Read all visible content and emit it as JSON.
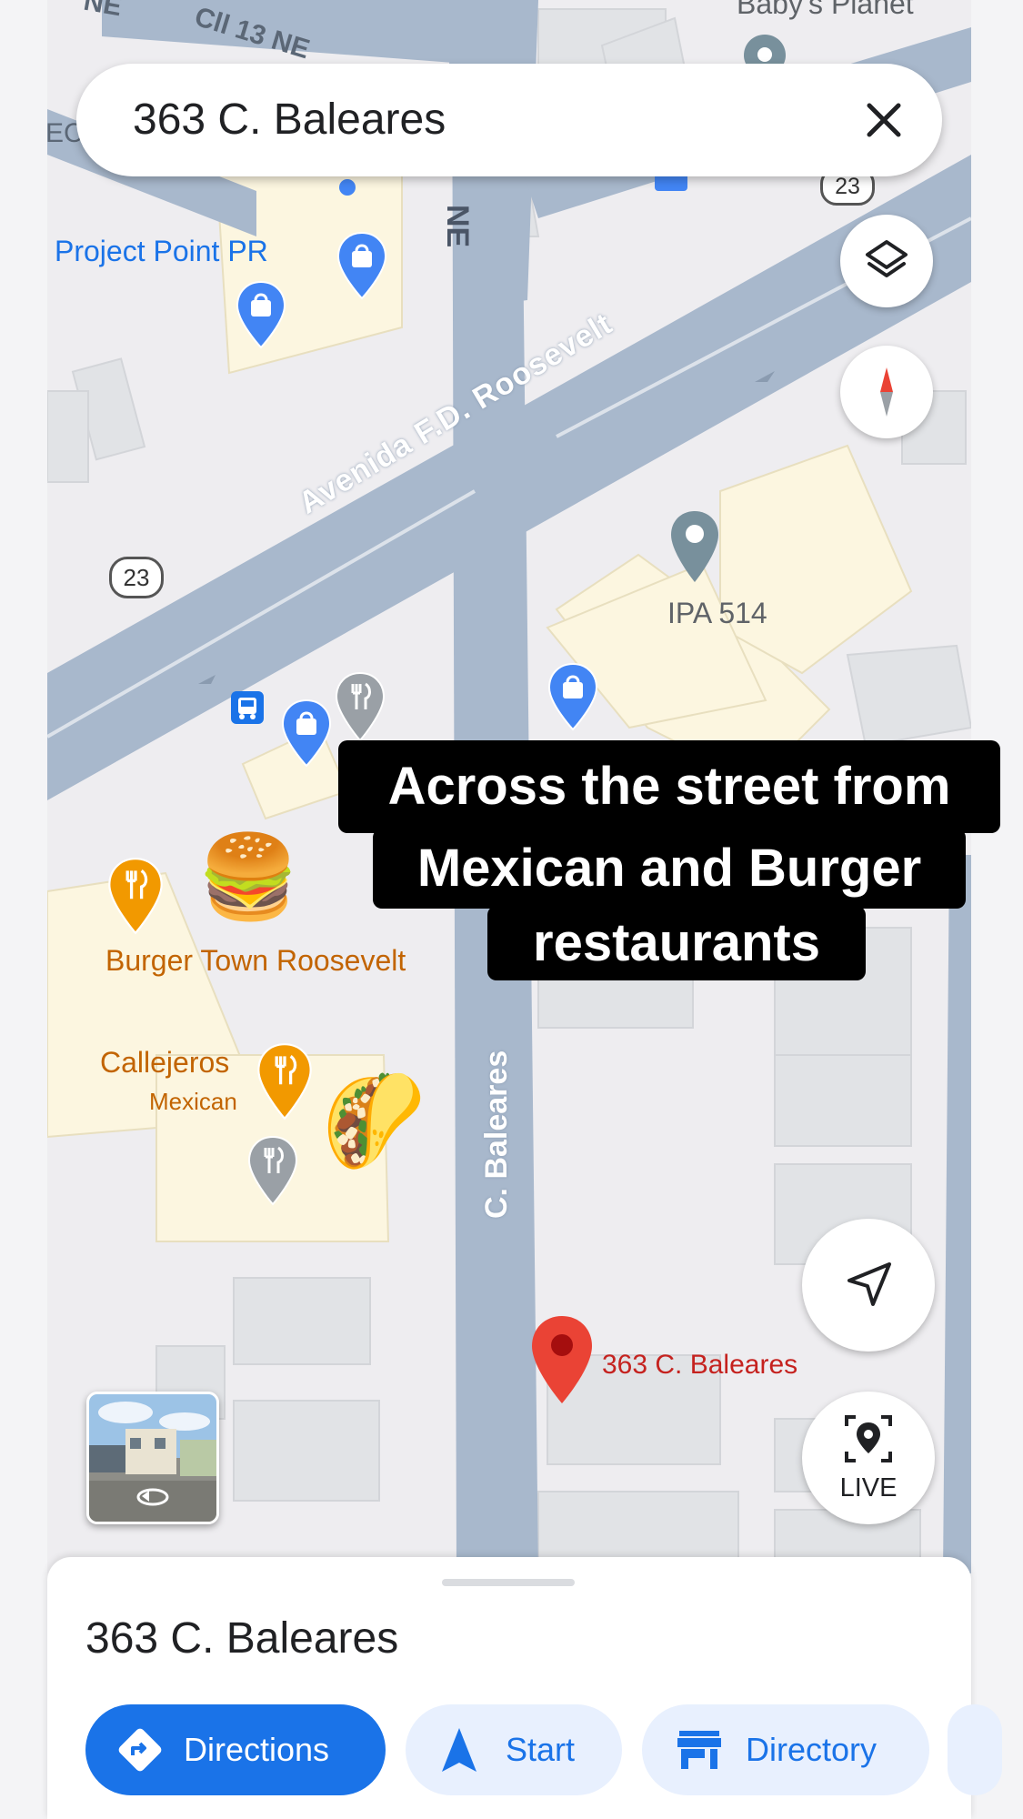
{
  "search": {
    "query": "363 C. Baleares"
  },
  "map_labels": {
    "street_cll13": "Cll 13 NE",
    "street_top_left": "NE",
    "street_ne_vertical": "NE",
    "avenue": "Avenida F.D. Roosevelt",
    "street_baleares": "C. Baleares",
    "route_shield_top": "23",
    "route_shield_left": "23",
    "edge_label_left": "EC",
    "babys_planet": "Baby's Planet",
    "project_point": "Project Point PR",
    "ipa": "IPA 514",
    "burger_town": "Burger Town Roosevelt",
    "callejeros": "Callejeros",
    "callejeros_category": "Mexican",
    "dropped_pin_label": "363 C. Baleares"
  },
  "overlay_caption": {
    "line1": "Across the street from",
    "line2": "Mexican and Burger",
    "line3": "restaurants"
  },
  "emojis": {
    "burger": "🍔",
    "taco": "🌮"
  },
  "controls": {
    "live_label": "LIVE"
  },
  "place_sheet": {
    "title": "363 C. Baleares",
    "actions": [
      {
        "label": "Directions",
        "icon": "directions-icon"
      },
      {
        "label": "Start",
        "icon": "navigation-arrow-icon"
      },
      {
        "label": "Directory",
        "icon": "store-icon"
      }
    ]
  },
  "colors": {
    "road": "#a8b8cc",
    "map_background": "#eeedf0",
    "building": "#fcf6e0",
    "shopping_pin": "#4285f4",
    "food_pin": "#f29900",
    "red_pin": "#ea4335",
    "primary_button": "#1a73e8"
  }
}
